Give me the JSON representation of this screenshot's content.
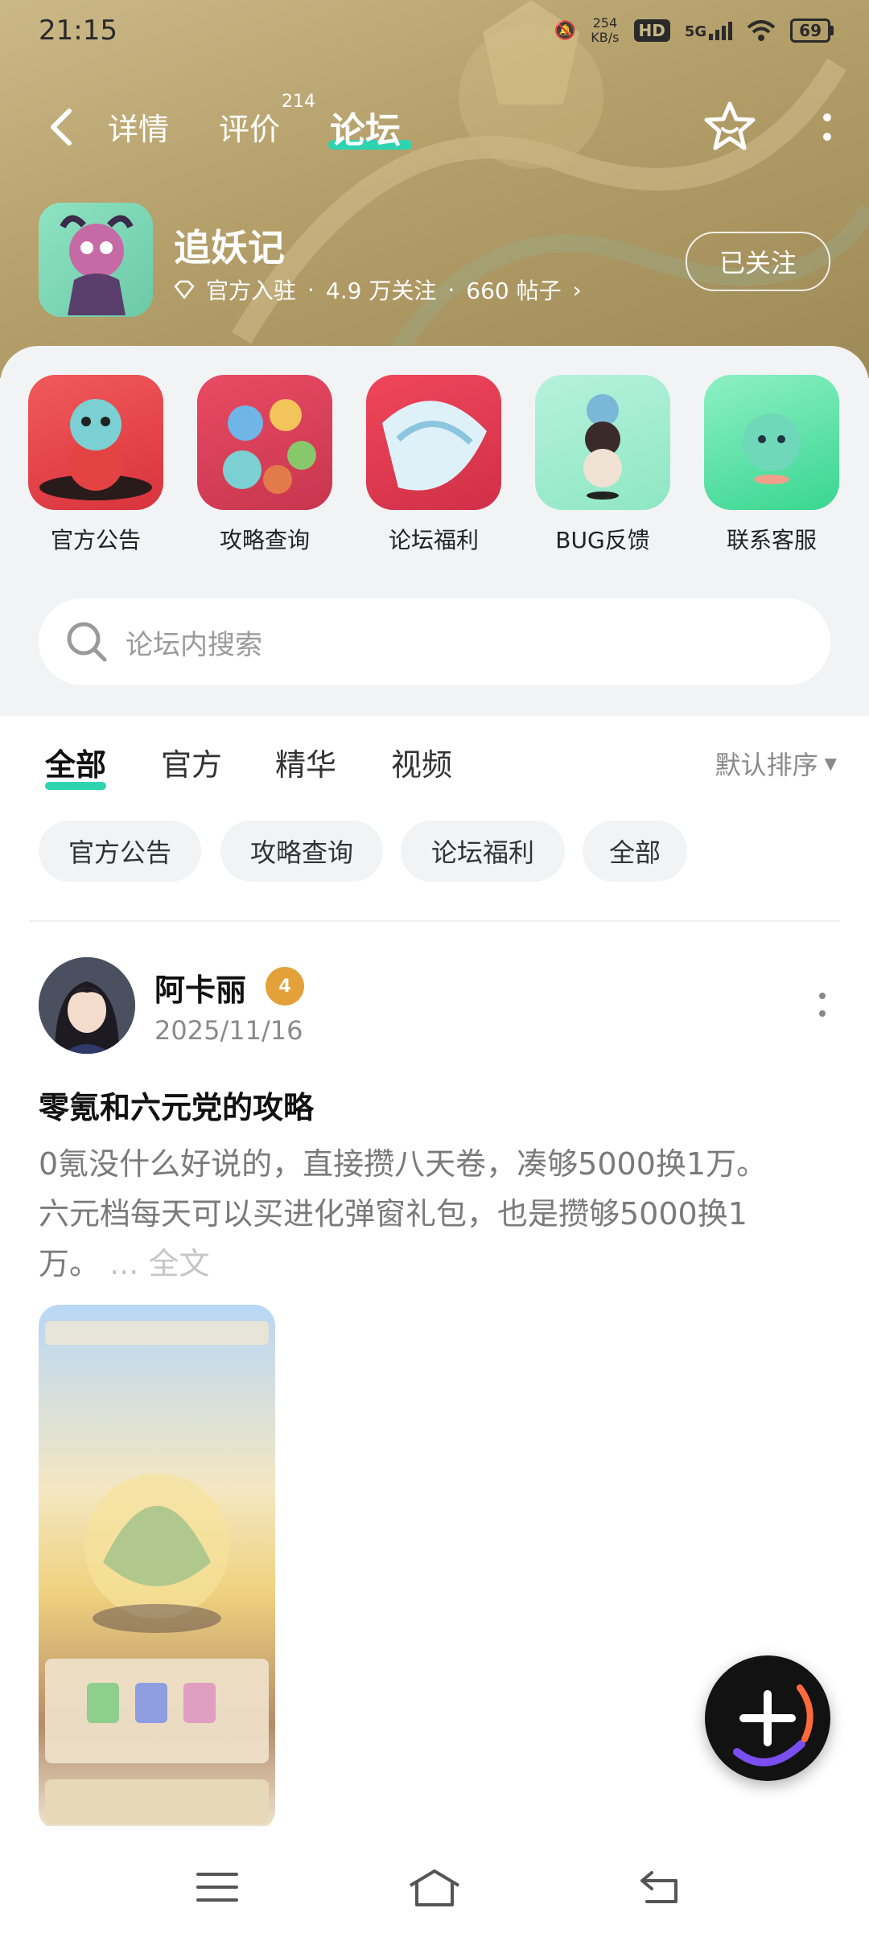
{
  "status_bar": {
    "time": "21:15",
    "speed_value": "254",
    "speed_unit": "KB/s",
    "hd": "HD",
    "network": "5G",
    "battery": "69"
  },
  "nav": {
    "tabs": [
      {
        "label": "详情"
      },
      {
        "label": "评价",
        "badge": "214"
      },
      {
        "label": "论坛"
      }
    ]
  },
  "app": {
    "title": "追妖记",
    "official": "官方入驻",
    "followers": "4.9 万关注",
    "posts": "660 帖子",
    "follow_label": "已关注"
  },
  "shortcuts": [
    {
      "label": "官方公告"
    },
    {
      "label": "攻略查询"
    },
    {
      "label": "论坛福利"
    },
    {
      "label": "BUG反馈"
    },
    {
      "label": "联系客服"
    }
  ],
  "search": {
    "placeholder": "论坛内搜索"
  },
  "filter_tabs": [
    {
      "label": "全部"
    },
    {
      "label": "官方"
    },
    {
      "label": "精华"
    },
    {
      "label": "视频"
    }
  ],
  "sort_label": "默认排序",
  "chips": [
    {
      "label": "官方公告"
    },
    {
      "label": "攻略查询"
    },
    {
      "label": "论坛福利"
    },
    {
      "label": "全部"
    }
  ],
  "post": {
    "author": "阿卡丽",
    "level": "4",
    "date": "2025/11/16",
    "title": "零氪和六元党的攻略",
    "body": "0氪没什么好说的，直接攒八天卷，凑够5000换1万。六元档每天可以买进化弹窗礼包，也是攒够5000换1万。",
    "ellipsis": "...",
    "read_more": "全文"
  },
  "colors": {
    "accent": "#2ed3b0",
    "hero": "#b49f6a",
    "panel": "#f2f3f5"
  }
}
